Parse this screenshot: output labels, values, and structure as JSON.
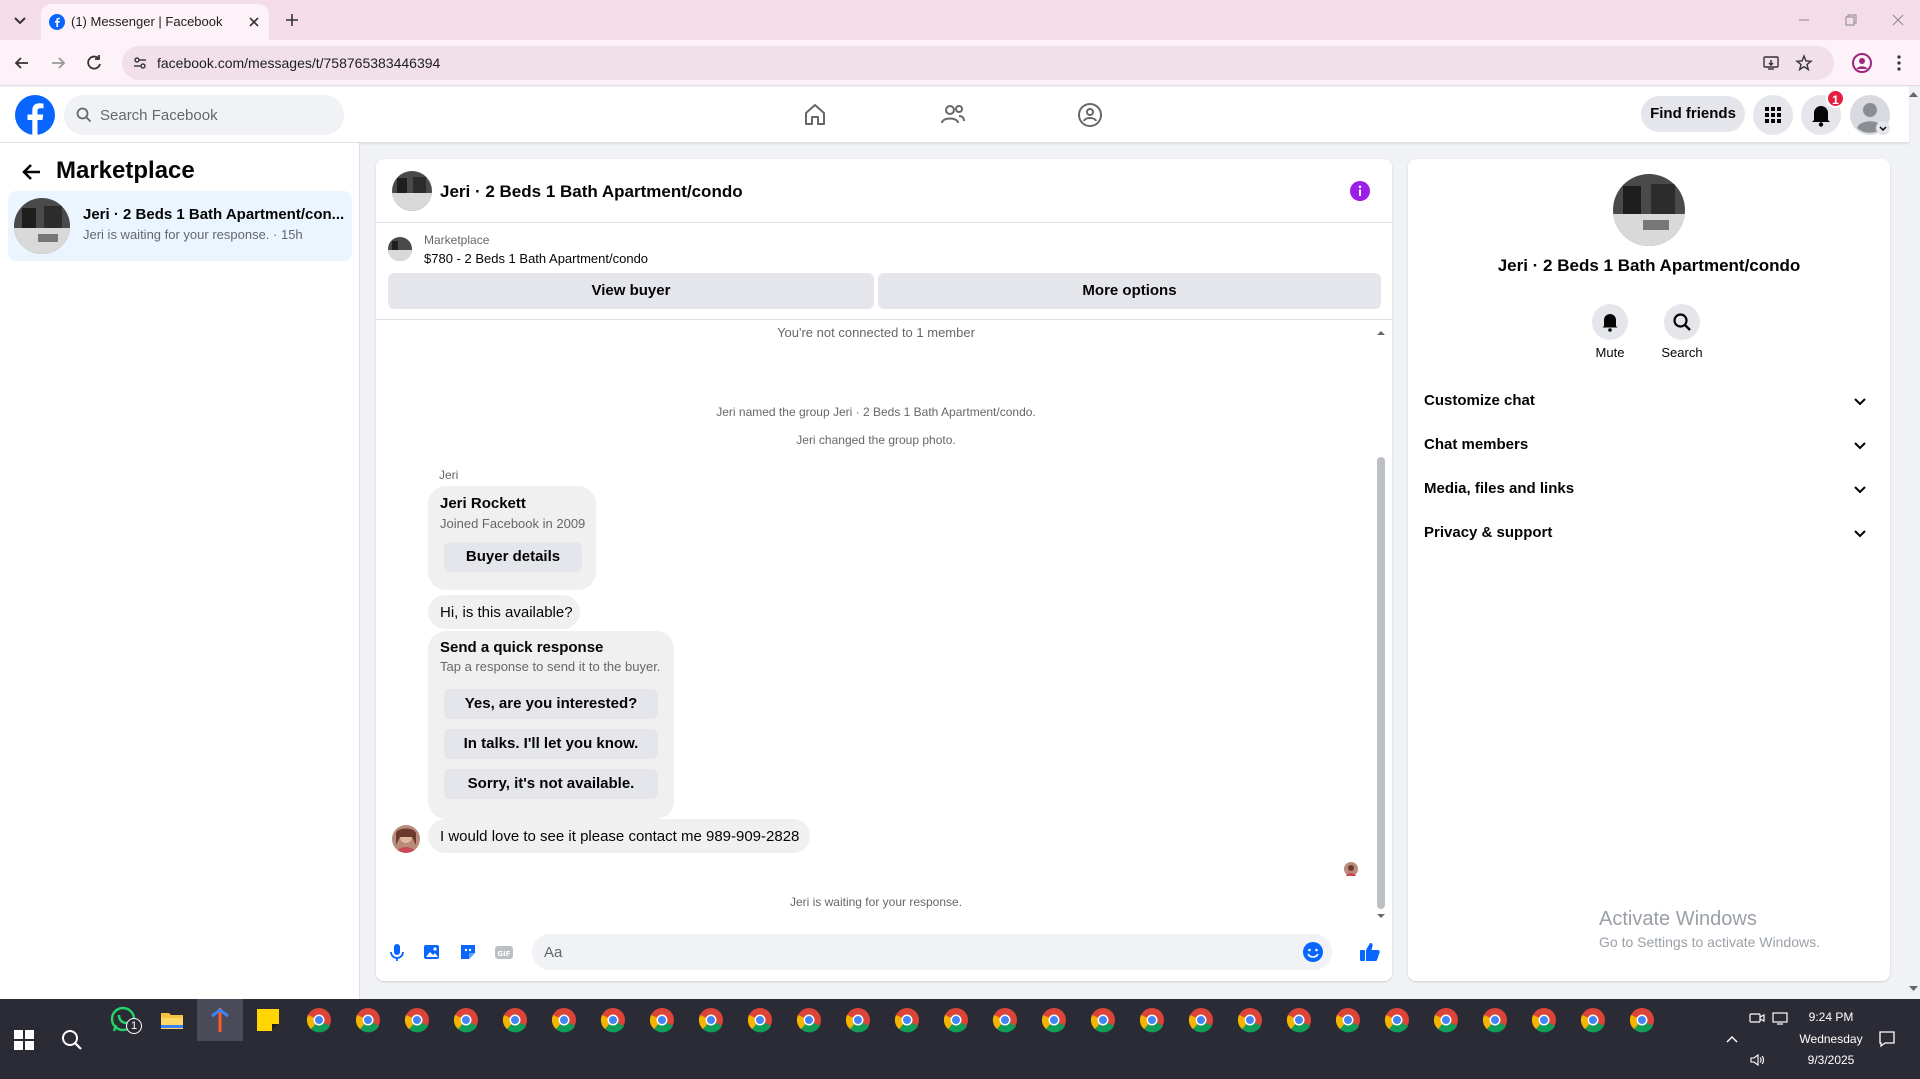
{
  "browser": {
    "tab_title": "(1) Messenger | Facebook",
    "url": "facebook.com/messages/t/758765383446394"
  },
  "fb_nav": {
    "search_placeholder": "Search Facebook",
    "find_friends": "Find friends",
    "notification_count": "1",
    "brand_color": "#0866ff"
  },
  "sidebar": {
    "title": "Marketplace",
    "conversation": {
      "name": "Jeri · 2 Beds 1 Bath Apartment/con...",
      "preview": "Jeri is waiting for your response. · 15h"
    }
  },
  "chat": {
    "title": "Jeri · 2 Beds 1 Bath Apartment/condo",
    "listing_source": "Marketplace",
    "listing_summary": "$780 - 2 Beds 1 Bath Apartment/condo",
    "view_buyer": "View buyer",
    "more_options": "More options",
    "system_messages": {
      "not_connected": "You're not connected to 1 member",
      "named_group": "Jeri named the group Jeri · 2 Beds 1 Bath Apartment/condo.",
      "changed_photo": "Jeri changed the group photo."
    },
    "sender_label": "Jeri",
    "buyer_card": {
      "name": "Jeri Rockett",
      "joined": "Joined Facebook in 2009",
      "button": "Buyer details"
    },
    "message_1": "Hi, is this available?",
    "quick_response": {
      "title": "Send a quick response",
      "subtitle": "Tap a response to send it to the buyer.",
      "options": [
        "Yes, are you interested?",
        "In talks. I'll let you know.",
        "Sorry, it's not available."
      ]
    },
    "message_2": "I would love to see it please contact me 989-909-2828",
    "waiting": "Jeri is waiting for your response.",
    "composer_placeholder": "Aa",
    "accent_color": "#0866ff",
    "info_button_color": "#9b1fe8"
  },
  "info_panel": {
    "title": "Jeri · 2 Beds 1 Bath Apartment/condo",
    "mute": "Mute",
    "search": "Search",
    "rows": [
      "Customize chat",
      "Chat members",
      "Media, files and links",
      "Privacy & support"
    ]
  },
  "watermark": {
    "line1": "Activate Windows",
    "line2": "Go to Settings to activate Windows."
  },
  "taskbar": {
    "whatsapp_badge": "1",
    "time": "9:24 PM",
    "day": "Wednesday",
    "date": "9/3/2025"
  }
}
